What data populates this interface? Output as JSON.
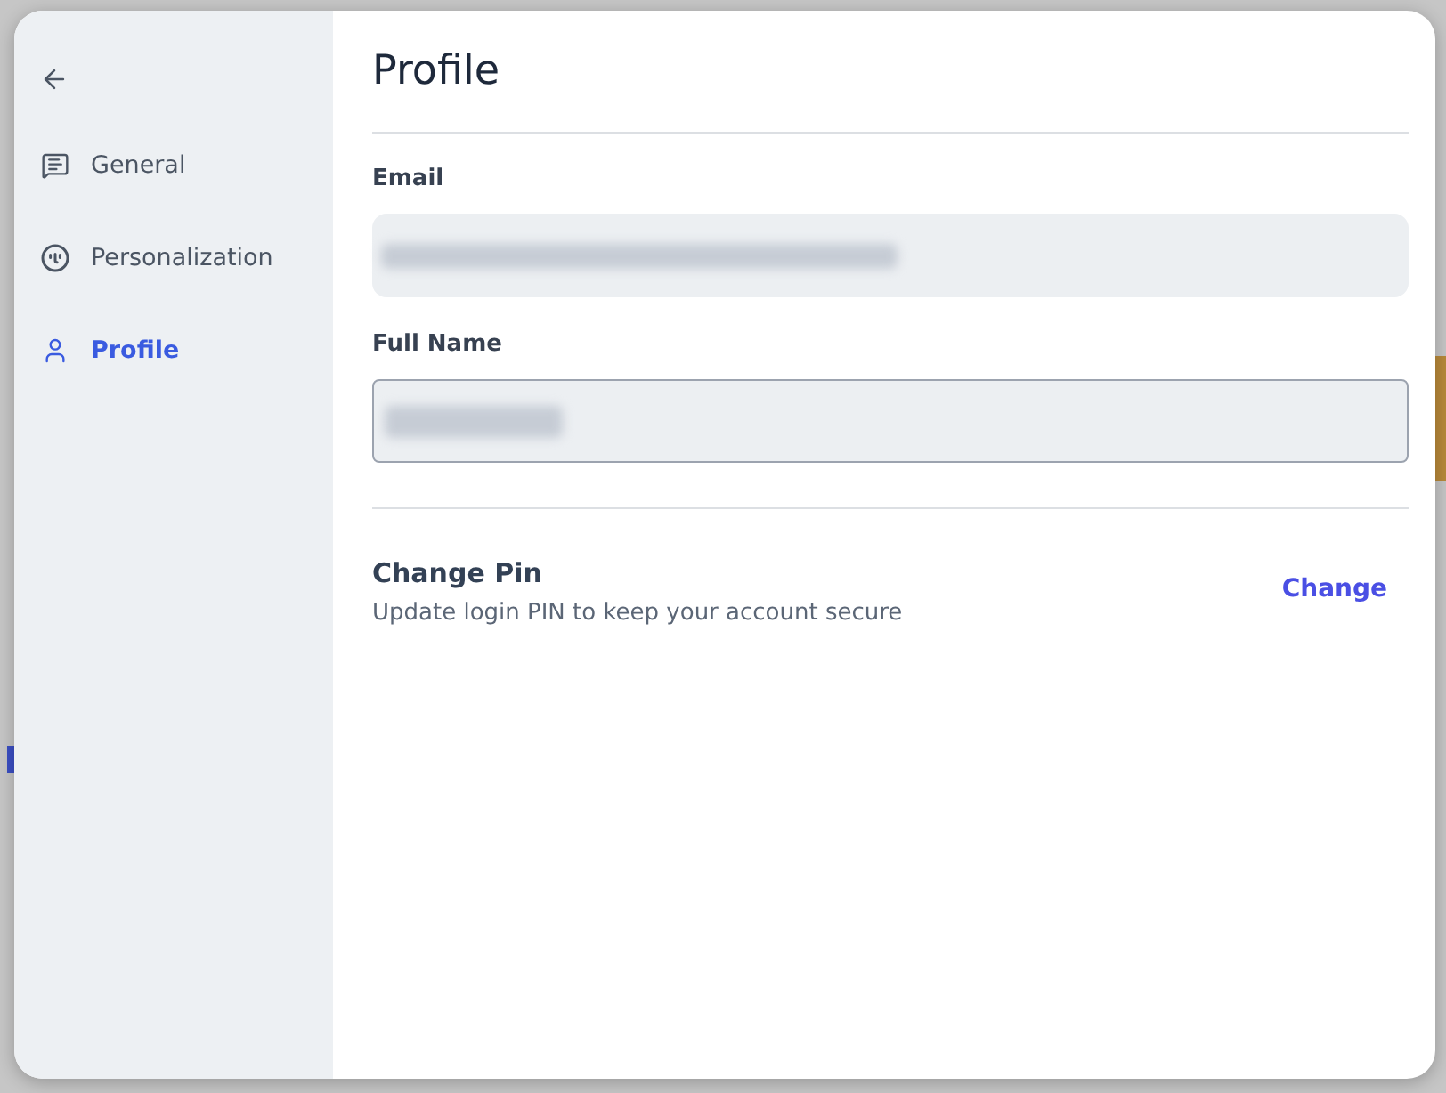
{
  "sidebar": {
    "items": [
      {
        "label": "General",
        "selected": false
      },
      {
        "label": "Personalization",
        "selected": false
      },
      {
        "label": "Profile",
        "selected": true
      }
    ]
  },
  "title": "Profile",
  "fields": [
    {
      "label": "Email",
      "kind": "email",
      "disabled": true,
      "redacted": true
    },
    {
      "label": "Full Name",
      "kind": "text",
      "disabled": false,
      "redacted": true
    }
  ],
  "change_pin": {
    "title": "Change Pin",
    "description": "Update login PIN to keep your account secure",
    "action": "Change"
  }
}
